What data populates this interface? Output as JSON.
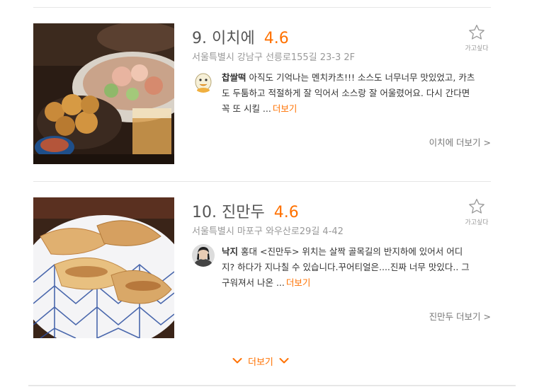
{
  "restaurants": [
    {
      "rank": "9.",
      "name": "이치에",
      "rating": "4.6",
      "address": "서울특별시 강남구 선릉로155길 23-3 2F",
      "wishlist_label": "가고싶다",
      "review": {
        "nickname": "찹쌀떡",
        "text": "아직도 기억나는 멘치카츠!!! 소스도 너무너무 맛있었고, 카츠도 두툼하고 적절하게 잘 익어서 소스랑 잘 어울렸어요. 다시 간다면 꼭 또 시킬 ...",
        "more_label": "더보기"
      },
      "more_label": "이치에 더보기 >"
    },
    {
      "rank": "10.",
      "name": "진만두",
      "rating": "4.6",
      "address": "서울특별시 마포구 와우산로29길 4-42",
      "wishlist_label": "가고싶다",
      "review": {
        "nickname": "낙지",
        "text": "홍대 <진만두> 위치는 살짝 골목길의 반지하에 있어서 어디지? 하다가 지나칠 수 있습니다.꾸어티얼은....진짜 너무 맛있다.. 그 구워져서 나온 ...",
        "more_label": "더보기"
      },
      "more_label": "진만두 더보기 >"
    }
  ],
  "load_more_label": "더보기",
  "colors": {
    "accent": "#ff7100",
    "muted": "#999999",
    "divider": "#e6e6e6"
  },
  "icons": [
    "star-outline-icon",
    "chevron-down-icon"
  ]
}
